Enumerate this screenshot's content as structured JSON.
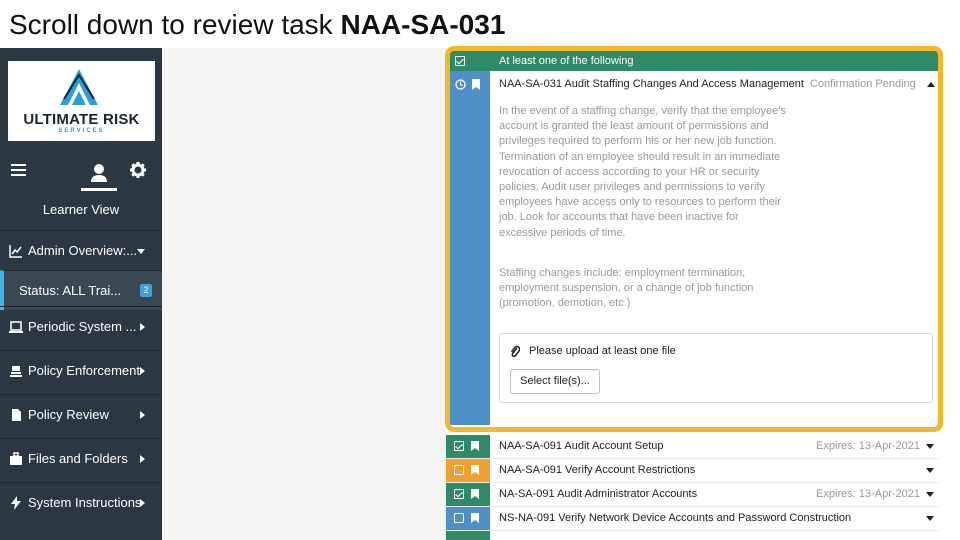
{
  "caption": {
    "prefix": "Scroll down to review task ",
    "task_id": "NAA-SA-031"
  },
  "brand": {
    "name": "ULTIMATE RISK",
    "sub": "SERVICES",
    "colors": {
      "blue": "#2a9fd8",
      "dark": "#1b2530"
    }
  },
  "sidebar": {
    "view_label": "Learner View",
    "icons": [
      "menu-icon",
      "user-icon",
      "gear-icon"
    ],
    "items": [
      {
        "label": "Admin Overview:...",
        "icon": "chart-line-icon",
        "caret": "down"
      },
      {
        "label": "Status: ALL Trai...",
        "badge": "2"
      },
      {
        "label": "Periodic System ...",
        "icon": "laptop-icon",
        "caret": "right"
      },
      {
        "label": "Policy Enforcement",
        "icon": "gavel-icon",
        "caret": "right"
      },
      {
        "label": "Policy Review",
        "icon": "file-icon",
        "caret": "right"
      },
      {
        "label": "Files and Folders",
        "icon": "briefcase-icon",
        "caret": "right"
      },
      {
        "label": "System Instructions",
        "icon": "bolt-icon",
        "caret": "right"
      }
    ]
  },
  "group": {
    "label": "At least one of the following"
  },
  "task": {
    "title": "NAA-SA-031 Audit Staffing Changes And Access Management",
    "status": "Confirmation Pending",
    "description_1": "In the event of a staffing change, verify that the employee's account is granted the least amount of permissions and privileges required to perform his or her new job function. Termination of an employee should result in an immediate revocation of access according to your HR or security policies. Audit user privileges and permissions to verify employees have access only to resources to perform their job. Look for accounts that have been inactive for excessive periods of time.",
    "description_2": "Staffing changes include: employment termination, employment suspension, or a change of job function (promotion, demotion, etc.)",
    "upload_label": "Please upload at least one file",
    "select_button": "Select file(s)..."
  },
  "rows": [
    {
      "title": "NAA-SA-091 Audit Account Setup",
      "expires": "Expires: 13-Apr-2021",
      "color": "#2f8a68",
      "checked": true
    },
    {
      "title": "NAA-SA-091 Verify Account Restrictions",
      "expires": "",
      "color": "#f0a030",
      "checked": false
    },
    {
      "title": "NA-SA-091 Audit Administrator Accounts",
      "expires": "Expires: 13-Apr-2021",
      "color": "#2f8a68",
      "checked": true
    },
    {
      "title": "NS-NA-091 Verify Network Device Accounts and Password Construction",
      "expires": "",
      "color": "#4e8fc8",
      "checked": false
    }
  ],
  "colors": {
    "highlight": "#f2b92b",
    "sidebar_bg": "#2b3742",
    "task_stripe": "#4e8fc8",
    "group_bar": "#2f8a68"
  }
}
